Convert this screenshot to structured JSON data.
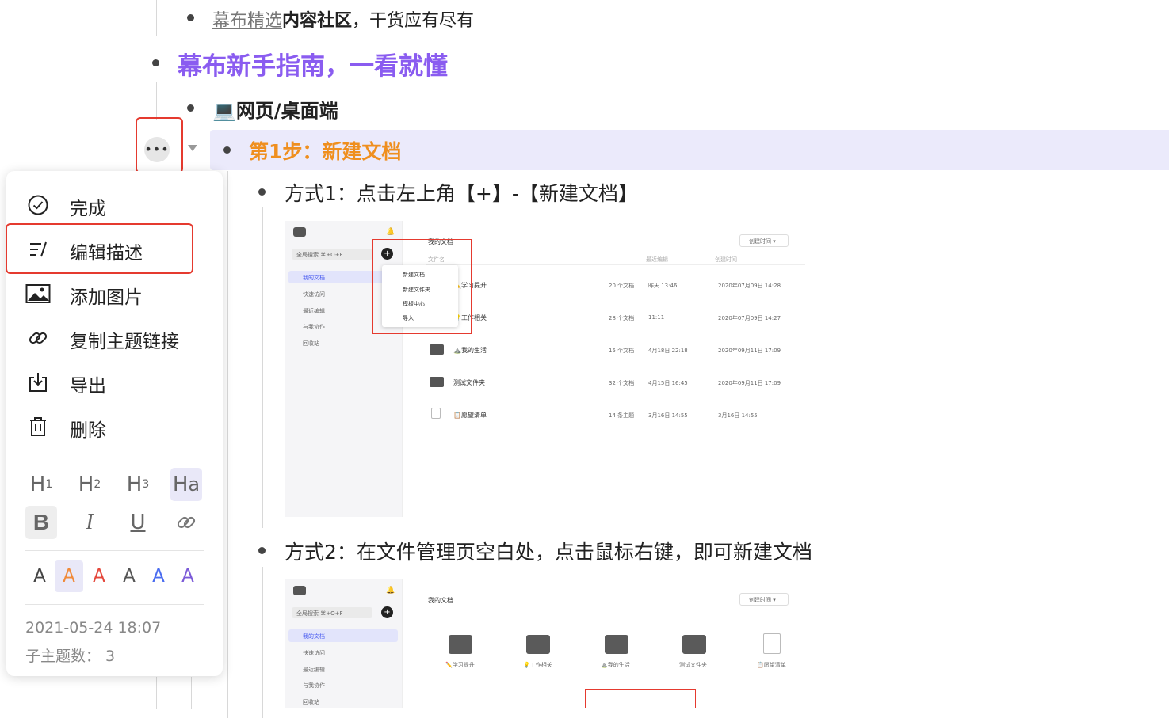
{
  "outline": {
    "item_top": {
      "link": "幕布精选",
      "bold": "内容社区",
      "rest": "，干货应有尽有"
    },
    "guide_title": "幕布新手指南，一看就懂",
    "web_title": "💻网页/桌面端",
    "step1_title": "第1步：新建文档",
    "method1": "方式1：点击左上角【+】-【新建文档】",
    "method2": "方式2：在文件管理页空白处，点击鼠标右键，即可新建文档"
  },
  "context_menu": {
    "items": [
      {
        "label": "完成",
        "icon": "check-circle-icon"
      },
      {
        "label": "编辑描述",
        "icon": "edit-description-icon"
      },
      {
        "label": "添加图片",
        "icon": "image-icon"
      },
      {
        "label": "复制主题链接",
        "icon": "link-icon"
      },
      {
        "label": "导出",
        "icon": "export-icon"
      },
      {
        "label": "删除",
        "icon": "trash-icon"
      }
    ],
    "headings": [
      "H1",
      "H2",
      "H3",
      "Ha"
    ],
    "text_styles": [
      "B",
      "I",
      "U",
      "link"
    ],
    "colors": [
      "#444444",
      "#f08a3a",
      "#e5483c",
      "#555555",
      "#4a6cf0",
      "#7b5ad8"
    ],
    "color_glyph": "A",
    "timestamp": "2021-05-24 18:07",
    "child_count_label": "子主题数：",
    "child_count": "3"
  },
  "screenshot1": {
    "search": "全局搜索 ⌘+O+F",
    "nav": [
      "我的文档",
      "快速访问",
      "最近编辑",
      "与我协作",
      "回收站"
    ],
    "title": "我的文档",
    "col_name": "文件名",
    "col_edited": "最近编辑",
    "col_created": "创建时间",
    "sort_btn": "创建时间 ▾",
    "popup": [
      "新建文档",
      "新建文件夹",
      "模板中心",
      "导入"
    ],
    "rows": [
      {
        "name": "✏️学习提升",
        "count": "20 个文档",
        "edited": "昨天 13:46",
        "created": "2020年07月09日 14:28"
      },
      {
        "name": "💡工作相关",
        "count": "28 个文档",
        "edited": "11:11",
        "created": "2020年07月09日 14:27"
      },
      {
        "name": "⛰️我的生活",
        "count": "15 个文档",
        "edited": "4月18日 22:18",
        "created": "2020年09月11日 17:09"
      },
      {
        "name": "测试文件夹",
        "count": "32 个文档",
        "edited": "4月15日 16:45",
        "created": "2020年09月11日 17:09"
      },
      {
        "name": "📋愿望清单",
        "count": "14 条主题",
        "edited": "3月16日 14:55",
        "created": "3月16日 14:55"
      }
    ]
  },
  "screenshot2": {
    "search": "全局搜索 ⌘+O+F",
    "nav": [
      "我的文档",
      "快速访问",
      "最近编辑",
      "与我协作",
      "回收站"
    ],
    "title": "我的文档",
    "sort_btn": "创建时间 ▾",
    "tiles": [
      "✏️学习提升",
      "💡工作相关",
      "⛰️我的生活",
      "测试文件夹",
      "📋愿望清单"
    ]
  }
}
